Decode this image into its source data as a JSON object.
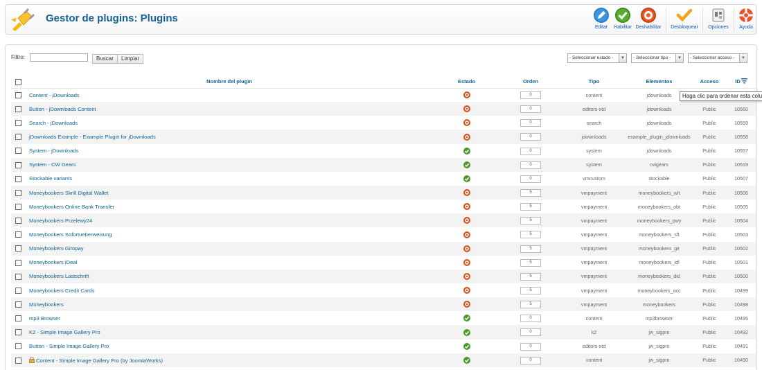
{
  "header": {
    "title": "Gestor de plugins: Plugins",
    "toolbar": [
      {
        "label": "Editar",
        "icon": "edit-icon"
      },
      {
        "label": "Habilitar",
        "icon": "enable-icon"
      },
      {
        "label": "Deshabilitar",
        "icon": "disable-icon"
      },
      {
        "label": "Desbloquear",
        "icon": "checkin-icon"
      },
      {
        "label": "Opciones",
        "icon": "options-icon"
      },
      {
        "label": "Ayuda",
        "icon": "help-icon"
      }
    ]
  },
  "filter": {
    "label": "Filtro:",
    "value": "",
    "search_label": "Buscar",
    "clear_label": "Limpiar",
    "state_select": "- Seleccionar estado -",
    "type_select": "- Seleccionar tipo -",
    "access_select": "- Seleccionar acceso -"
  },
  "columns": {
    "name": "Nombre del plugin",
    "state": "Estado",
    "order": "Orden",
    "type": "Tipo",
    "elements": "Elementos",
    "access": "Acceso",
    "id": "ID"
  },
  "colors": {
    "link": "#146295",
    "enabled": "#4a9a2a",
    "disabled": "#d9531e"
  },
  "tooltip": "Haga clic para ordenar esta columna",
  "rows": [
    {
      "name": "Content - jDownloads",
      "enabled": false,
      "order": "0",
      "type": "content",
      "element": "jdownloads",
      "access": "Public",
      "id": "10561",
      "locked": false
    },
    {
      "name": "Button - jDownloads Content",
      "enabled": false,
      "order": "0",
      "type": "editors-xtd",
      "element": "jdownloads",
      "access": "Public",
      "id": "10560",
      "locked": false
    },
    {
      "name": "Search - jDownloads",
      "enabled": false,
      "order": "0",
      "type": "search",
      "element": "jdownloads",
      "access": "Public",
      "id": "10559",
      "locked": false
    },
    {
      "name": "jDownloads Example - Example Plugin for jDownloads",
      "enabled": false,
      "order": "0",
      "type": "jdownloads",
      "element": "example_plugin_jdownloads",
      "access": "Public",
      "id": "10558",
      "locked": false
    },
    {
      "name": "System - jDownloads",
      "enabled": true,
      "order": "0",
      "type": "system",
      "element": "jdownloads",
      "access": "Public",
      "id": "10557",
      "locked": false
    },
    {
      "name": "System - CW Gears",
      "enabled": true,
      "order": "0",
      "type": "system",
      "element": "cwgears",
      "access": "Public",
      "id": "10519",
      "locked": false
    },
    {
      "name": "Stockable variants",
      "enabled": true,
      "order": "0",
      "type": "vmcustom",
      "element": "stockable",
      "access": "Public",
      "id": "10507",
      "locked": false
    },
    {
      "name": "Moneybookers Skrill Digital Wallet",
      "enabled": false,
      "order": "5",
      "type": "vmpayment",
      "element": "moneybookers_wlt",
      "access": "Public",
      "id": "10506",
      "locked": false
    },
    {
      "name": "Moneybookers Online Bank Transfer",
      "enabled": false,
      "order": "5",
      "type": "vmpayment",
      "element": "moneybookers_obt",
      "access": "Public",
      "id": "10505",
      "locked": false
    },
    {
      "name": "Moneybookers Przelewy24",
      "enabled": false,
      "order": "5",
      "type": "vmpayment",
      "element": "moneybookers_pwy",
      "access": "Public",
      "id": "10504",
      "locked": false
    },
    {
      "name": "Moneybookers Sofortueberweisung",
      "enabled": false,
      "order": "5",
      "type": "vmpayment",
      "element": "moneybookers_sft",
      "access": "Public",
      "id": "10503",
      "locked": false
    },
    {
      "name": "Moneybookers Giropay",
      "enabled": false,
      "order": "5",
      "type": "vmpayment",
      "element": "moneybookers_gir",
      "access": "Public",
      "id": "10502",
      "locked": false
    },
    {
      "name": "Moneybookers iDeal",
      "enabled": false,
      "order": "5",
      "type": "vmpayment",
      "element": "moneybookers_idl",
      "access": "Public",
      "id": "10501",
      "locked": false
    },
    {
      "name": "Moneybookers Lastschrift",
      "enabled": false,
      "order": "5",
      "type": "vmpayment",
      "element": "moneybookers_did",
      "access": "Public",
      "id": "10500",
      "locked": false
    },
    {
      "name": "Moneybookers Credit Cards",
      "enabled": false,
      "order": "5",
      "type": "vmpayment",
      "element": "moneybookers_acc",
      "access": "Public",
      "id": "10499",
      "locked": false
    },
    {
      "name": "Moneybookers",
      "enabled": false,
      "order": "5",
      "type": "vmpayment",
      "element": "moneybookers",
      "access": "Public",
      "id": "10498",
      "locked": false
    },
    {
      "name": "mp3 Browser",
      "enabled": true,
      "order": "0",
      "type": "content",
      "element": "mp3browser",
      "access": "Public",
      "id": "10495",
      "locked": false
    },
    {
      "name": "K2 - Simple Image Gallery Pro",
      "enabled": true,
      "order": "0",
      "type": "k2",
      "element": "jw_sigpro",
      "access": "Public",
      "id": "10492",
      "locked": false
    },
    {
      "name": "Button - Simple Image Gallery Pro",
      "enabled": true,
      "order": "0",
      "type": "editors-xtd",
      "element": "jw_sigpro",
      "access": "Public",
      "id": "10491",
      "locked": false
    },
    {
      "name": "Content - Simple Image Gallery Pro (by JoomlaWorks)",
      "enabled": true,
      "order": "0",
      "type": "content",
      "element": "jw_sigpro",
      "access": "Public",
      "id": "10490",
      "locked": true
    }
  ]
}
